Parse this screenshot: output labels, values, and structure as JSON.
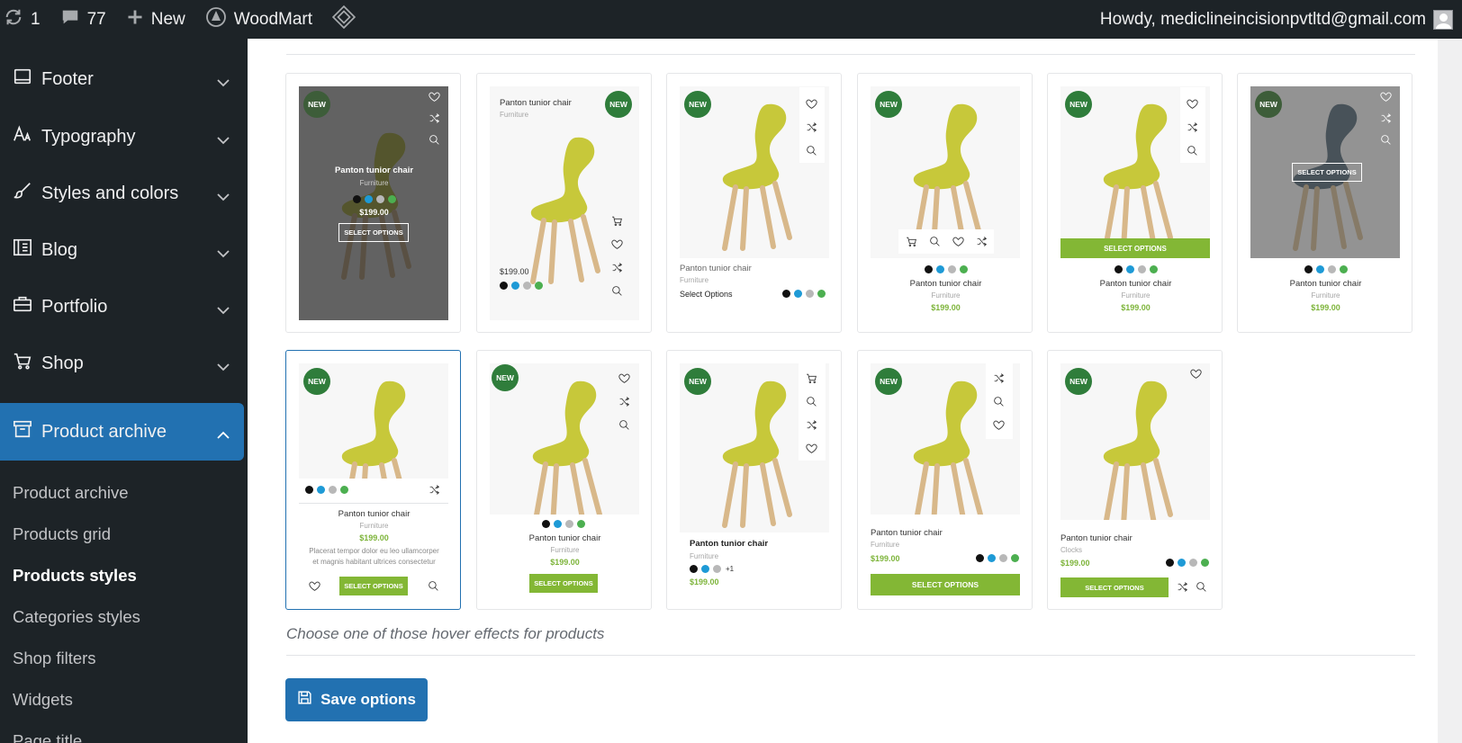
{
  "admin_bar": {
    "updates_count": "1",
    "comments_count": "77",
    "new_label": "New",
    "site_name": "WoodMart",
    "howdy": "Howdy, mediclineincisionpvtltd@gmail.com"
  },
  "sidebar": {
    "items": [
      {
        "label": "Footer",
        "icon": "footer-icon"
      },
      {
        "label": "Typography",
        "icon": "typography-icon"
      },
      {
        "label": "Styles and colors",
        "icon": "brush-icon"
      },
      {
        "label": "Blog",
        "icon": "blog-icon"
      },
      {
        "label": "Portfolio",
        "icon": "briefcase-icon"
      },
      {
        "label": "Shop",
        "icon": "cart-icon"
      },
      {
        "label": "Product archive",
        "icon": "archive-icon"
      }
    ],
    "subitems": [
      "Product archive",
      "Products grid",
      "Products styles",
      "Categories styles",
      "Shop filters",
      "Widgets",
      "Page title"
    ],
    "current_subitem": "Products styles"
  },
  "products": {
    "badge": "NEW",
    "title": "Panton tunior chair",
    "category": "Furniture",
    "category_alt": "Clocks",
    "price": "$199.00",
    "button": "SELECT OPTIONS",
    "button_text_link": "Select Options",
    "description_1": "Placerat tempor dolor eu leo ullamcorper",
    "description_2": "et magnis habitant ultrices consectetur",
    "more_swatches": "+1",
    "swatch_colors": [
      "#111111",
      "#1e9ad6",
      "#b8b8b8",
      "#4caf50"
    ]
  },
  "hint": "Choose one of those hover effects for products",
  "save_button": "Save options",
  "colors": {
    "admin_dark": "#1d2327",
    "accent_blue": "#2271b1",
    "badge_green": "#2f7d3b",
    "button_green": "#83b735"
  }
}
